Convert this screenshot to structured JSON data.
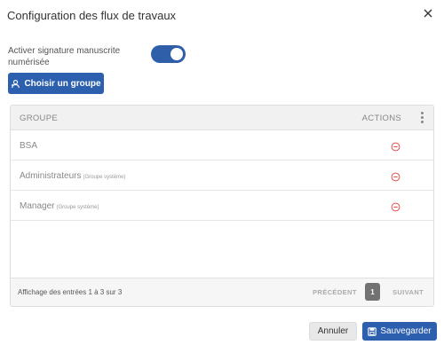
{
  "dialog": {
    "title": "Configuration des flux de travaux",
    "close_icon": "close-icon"
  },
  "toggle": {
    "label": "Activer signature manuscrite numérisée",
    "enabled": true,
    "accent": "#2f5fa8"
  },
  "choose_group": {
    "label": "Choisir un groupe",
    "icon": "users-icon"
  },
  "table": {
    "headers": {
      "group": "GROUPE",
      "actions": "ACTIONS"
    },
    "more_icon": "more-vertical-icon",
    "rows": [
      {
        "name": "BSA",
        "sub": ""
      },
      {
        "name": "Administrateurs",
        "sub": "(Groupe système)"
      },
      {
        "name": "Manager",
        "sub": "(Groupe système)"
      }
    ],
    "remove_icon": "remove-circle-icon",
    "remove_color": "#e0524f",
    "footer": {
      "info": "Affichage des entrées 1 à 3 sur 3",
      "prev": "PRÉCÉDENT",
      "page": "1",
      "next": "SUIVANT"
    }
  },
  "actions": {
    "cancel": "Annuler",
    "save": "Sauvegarder",
    "save_icon": "save-icon",
    "primary_color": "#2c5fae"
  }
}
